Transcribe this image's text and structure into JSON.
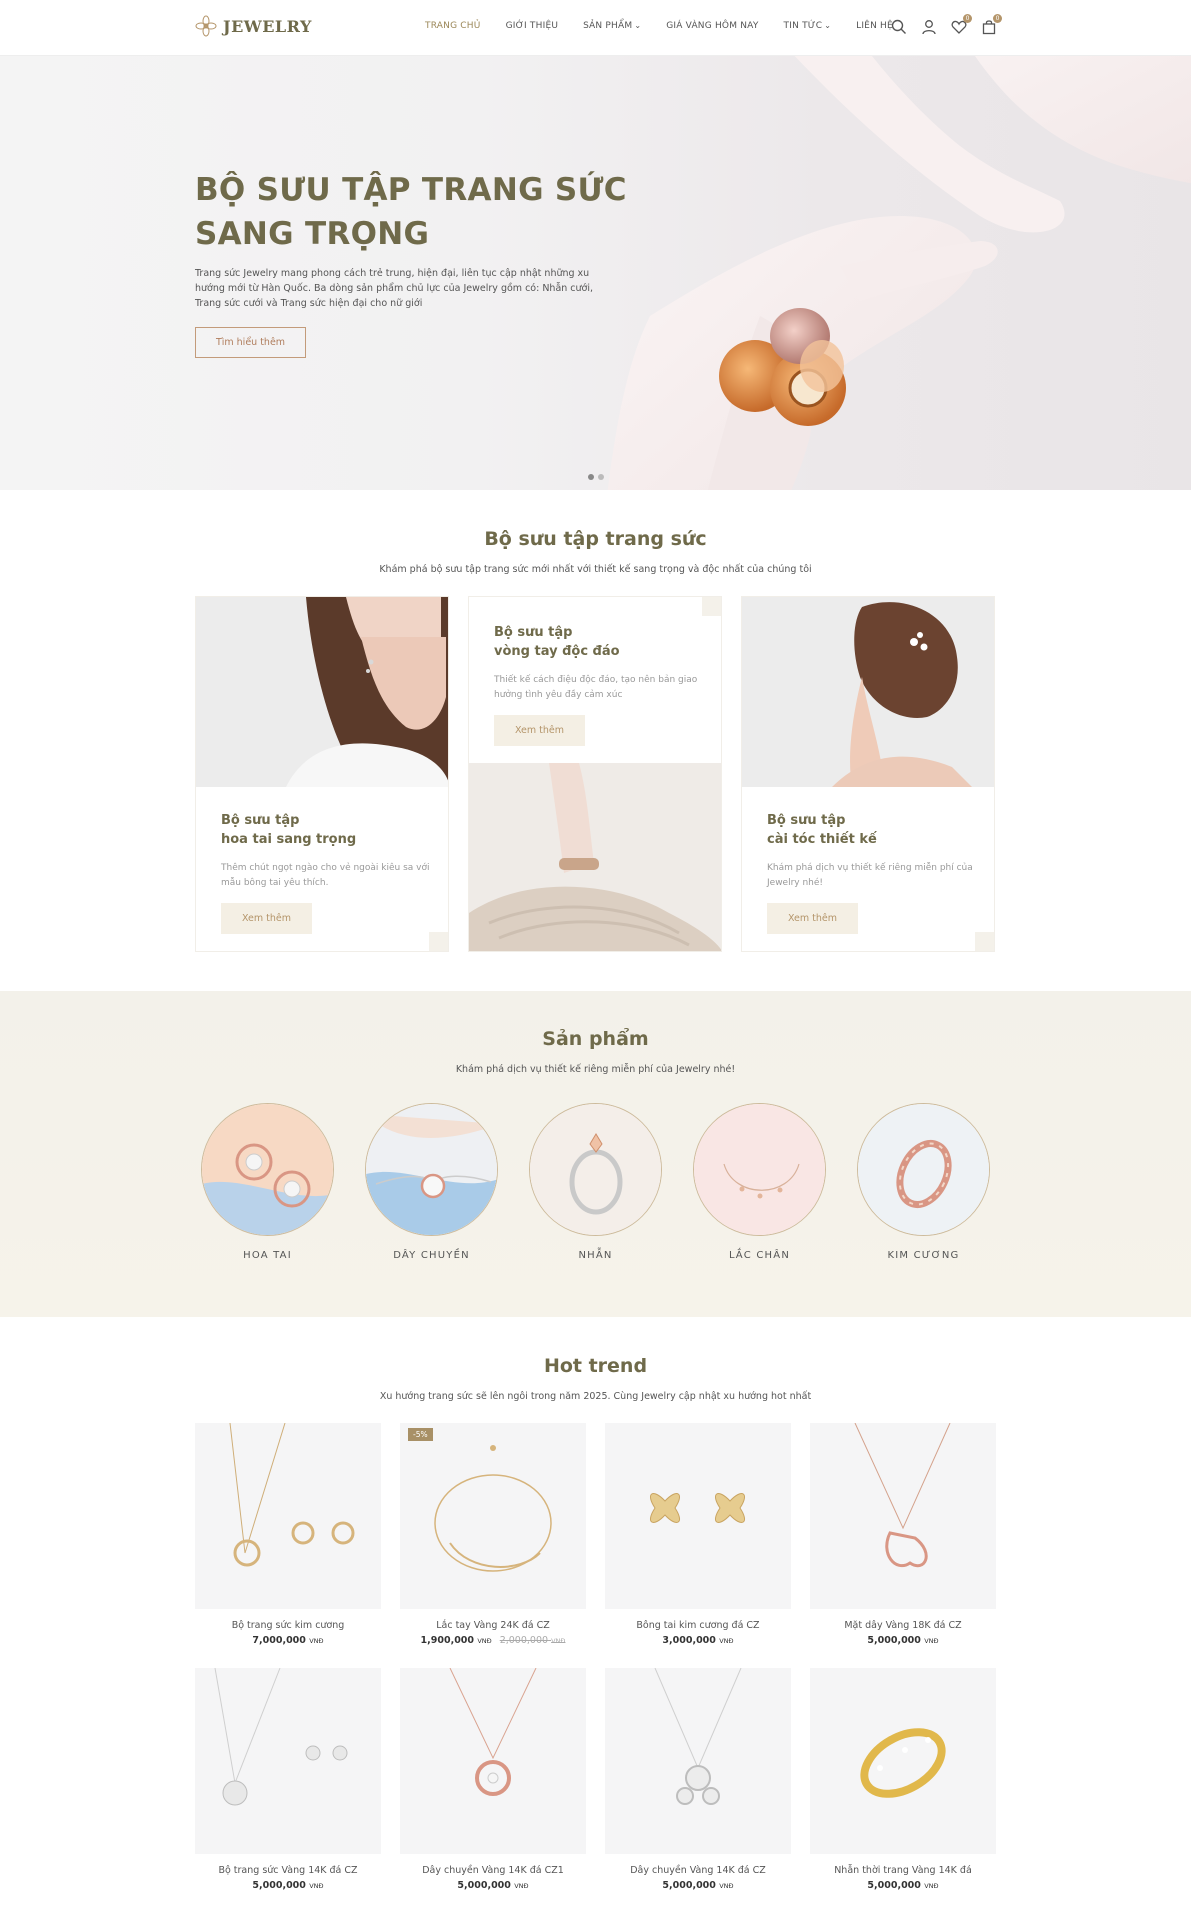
{
  "header": {
    "logo_text": "JEWELRY",
    "nav": [
      {
        "label": "TRANG CHỦ",
        "active": true,
        "dropdown": false
      },
      {
        "label": "GIỚI THIỆU",
        "active": false,
        "dropdown": false
      },
      {
        "label": "SẢN PHẨM",
        "active": false,
        "dropdown": true
      },
      {
        "label": "GIÁ VÀNG HÔM NAY",
        "active": false,
        "dropdown": false
      },
      {
        "label": "TIN TỨC",
        "active": false,
        "dropdown": true
      },
      {
        "label": "LIÊN HỆ",
        "active": false,
        "dropdown": false
      }
    ],
    "wishlist_count": "0",
    "cart_count": "0"
  },
  "hero": {
    "title": "BỘ SƯU TẬP TRANG SỨC SANG TRỌNG",
    "description": "Trang sức Jewelry mang phong cách trẻ trung, hiện đại, liên tục cập nhật những xu hướng mới từ Hàn Quốc. Ba dòng sản phẩm chủ lực của Jewelry gồm có: Nhẫn cưới, Trang sức cưới và Trang sức hiện đại cho nữ giới",
    "button": "Tìm hiểu thêm",
    "slides": 2,
    "active_slide": 1
  },
  "collection": {
    "title": "Bộ sưu tập trang sức",
    "subtitle": "Khám phá bộ sưu tập trang sức mới nhất với thiết kế sang trọng và độc nhất của chúng tôi",
    "cards": [
      {
        "title_line1": "Bộ sưu tập",
        "title_line2": "hoa tai sang trọng",
        "text": "Thêm chút ngọt ngào cho vẻ ngoài kiêu sa với mẫu bông tai yêu thích.",
        "button": "Xem thêm"
      },
      {
        "title_line1": "Bộ sưu tập",
        "title_line2": "vòng tay độc đáo",
        "text": "Thiết kế cách điệu độc đáo, tạo nên bản giao hưởng tình yêu đầy cảm xúc",
        "button": "Xem thêm"
      },
      {
        "title_line1": "Bộ sưu tập",
        "title_line2": "cài tóc thiết kế",
        "text": "Khám phá dịch vụ thiết kế riêng miễn phí của Jewelry nhé!",
        "button": "Xem thêm"
      }
    ]
  },
  "products": {
    "title": "Sản phẩm",
    "subtitle": "Khám phá dịch vụ thiết kế riêng miễn phí của Jewelry nhé!",
    "categories": [
      "HOA TAI",
      "DÂY CHUYỀN",
      "NHẪN",
      "LẮC CHÂN",
      "KIM CƯƠNG"
    ]
  },
  "hot_trend": {
    "title": "Hot trend",
    "subtitle": "Xu hướng trang sức sẽ lên ngôi trong năm 2025. Cùng Jewelry cập nhật xu hướng hot nhất",
    "currency": "VNĐ",
    "items": [
      {
        "name": "Bộ trang sức kim cương",
        "price": "7,000,000",
        "old_price": "",
        "sale": ""
      },
      {
        "name": "Lắc tay Vàng 24K đá CZ",
        "price": "1,900,000",
        "old_price": "2,000,000",
        "sale": "-5%"
      },
      {
        "name": "Bông tai kim cương đá CZ",
        "price": "3,000,000",
        "old_price": "",
        "sale": ""
      },
      {
        "name": "Mặt dây Vàng 18K đá CZ",
        "price": "5,000,000",
        "old_price": "",
        "sale": ""
      },
      {
        "name": "Bộ trang sức Vàng 14K đá CZ",
        "price": "5,000,000",
        "old_price": "",
        "sale": ""
      },
      {
        "name": "Dây chuyền Vàng 14K đá CZ1",
        "price": "5,000,000",
        "old_price": "",
        "sale": ""
      },
      {
        "name": "Dây chuyền Vàng 14K đá CZ",
        "price": "5,000,000",
        "old_price": "",
        "sale": ""
      },
      {
        "name": "Nhẫn thời trang Vàng 14K đá",
        "price": "5,000,000",
        "old_price": "",
        "sale": ""
      }
    ]
  },
  "colors": {
    "brand_olive": "#6f6a4a",
    "accent_gold": "#b4956a",
    "button_bg": "#f4efe4",
    "section_bg": "#f4f2eb"
  }
}
